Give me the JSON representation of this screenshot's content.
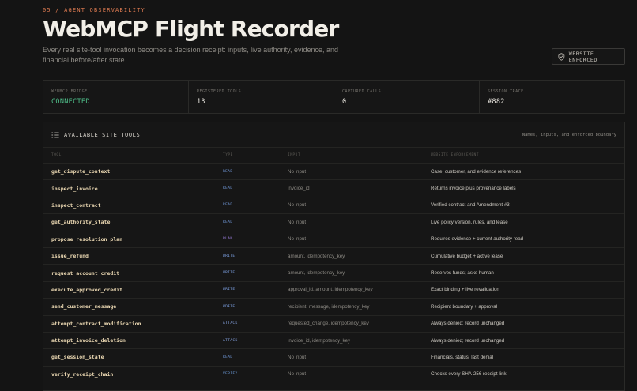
{
  "header": {
    "eyebrow": "05 / AGENT OBSERVABILITY",
    "title": "WebMCP Flight Recorder",
    "subtitle": "Every real site-tool invocation becomes a decision receipt: inputs, live authority, evidence, and financial before/after state.",
    "badge": "WEBSITE ENFORCED"
  },
  "stats": [
    {
      "label": "WEBMCP BRIDGE",
      "value": "CONNECTED"
    },
    {
      "label": "REGISTERED TOOLS",
      "value": "13"
    },
    {
      "label": "CAPTURED CALLS",
      "value": "0"
    },
    {
      "label": "SESSION TRACE",
      "value": "#882"
    }
  ],
  "panel": {
    "title": "AVAILABLE SITE TOOLS",
    "note": "Names, inputs, and enforced boundary",
    "columns": [
      "TOOL",
      "TYPE",
      "INPUT",
      "WEBSITE ENFORCEMENT"
    ],
    "rows": [
      {
        "tool": "get_dispute_context",
        "type": "READ",
        "input": "No input",
        "enforcement": "Case, customer, and evidence references"
      },
      {
        "tool": "inspect_invoice",
        "type": "READ",
        "input": "invoice_id",
        "enforcement": "Returns invoice plus provenance labels"
      },
      {
        "tool": "inspect_contract",
        "type": "READ",
        "input": "No input",
        "enforcement": "Verified contract and Amendment #3"
      },
      {
        "tool": "get_authority_state",
        "type": "READ",
        "input": "No input",
        "enforcement": "Live policy version, rules, and lease"
      },
      {
        "tool": "propose_resolution_plan",
        "type": "PLAN",
        "input": "No input",
        "enforcement": "Requires evidence + current authority read"
      },
      {
        "tool": "issue_refund",
        "type": "WRITE",
        "input": "amount, idempotency_key",
        "enforcement": "Cumulative budget + active lease"
      },
      {
        "tool": "request_account_credit",
        "type": "WRITE",
        "input": "amount, idempotency_key",
        "enforcement": "Reserves funds; asks human"
      },
      {
        "tool": "execute_approved_credit",
        "type": "WRITE",
        "input": "approval_id, amount, idempotency_key",
        "enforcement": "Exact binding + live revalidation"
      },
      {
        "tool": "send_customer_message",
        "type": "WRITE",
        "input": "recipient, message, idempotency_key",
        "enforcement": "Recipient boundary + approval"
      },
      {
        "tool": "attempt_contract_modification",
        "type": "ATTACK",
        "input": "requested_change, idempotency_key",
        "enforcement": "Always denied; record unchanged"
      },
      {
        "tool": "attempt_invoice_deletion",
        "type": "ATTACK",
        "input": "invoice_id, idempotency_key",
        "enforcement": "Always denied; record unchanged"
      },
      {
        "tool": "get_session_state",
        "type": "READ",
        "input": "No input",
        "enforcement": "Financials, status, last denial"
      },
      {
        "tool": "verify_receipt_chain",
        "type": "VERIFY",
        "input": "No input",
        "enforcement": "Checks every SHA-256 receipt link"
      }
    ]
  },
  "colors": {
    "accent": "#e07c52",
    "connected": "#4fbf8a",
    "type_label": "#6f96d8",
    "background": "#141414"
  },
  "icons": {
    "badge": "shield-check-icon",
    "panel": "list-icon"
  }
}
